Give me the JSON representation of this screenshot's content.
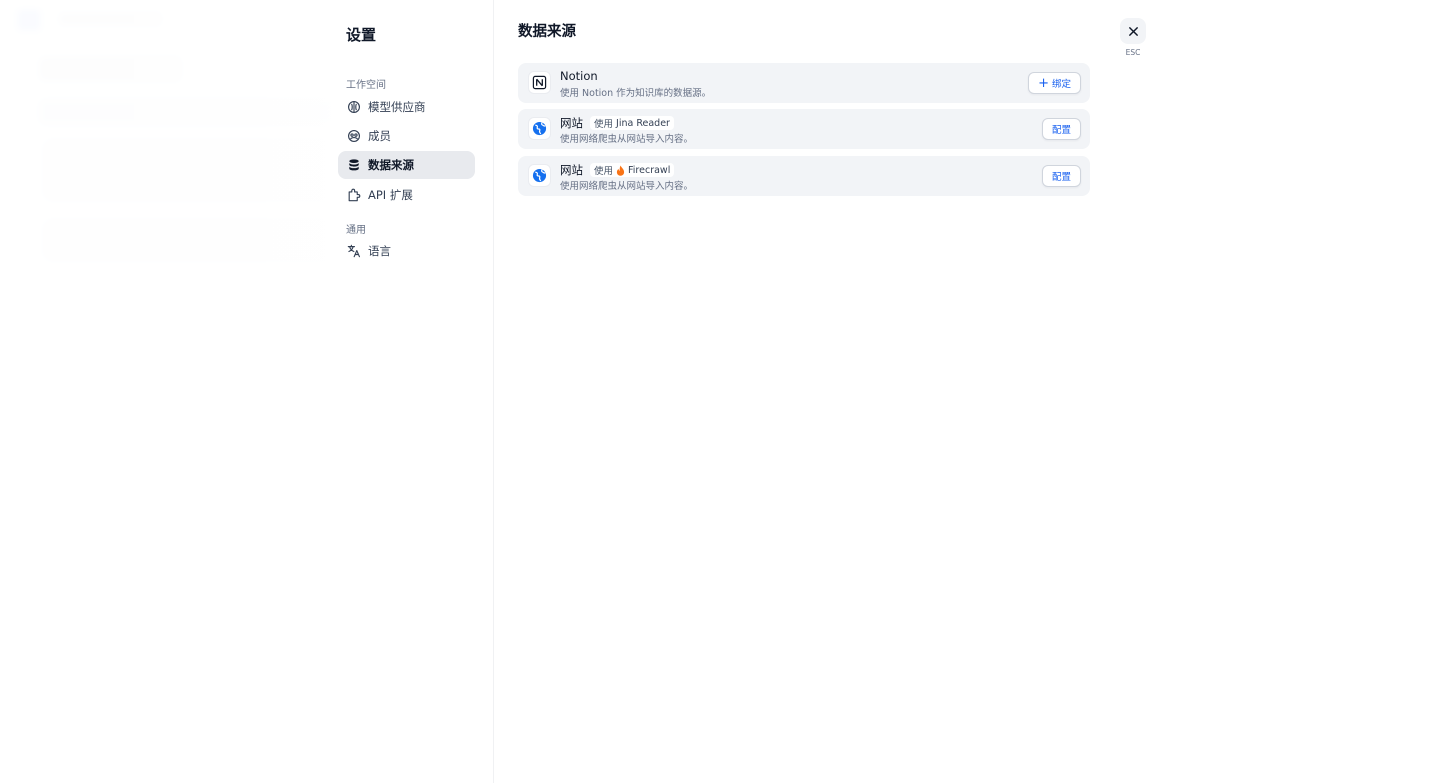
{
  "sidebar": {
    "title": "设置",
    "groups": [
      {
        "label": "工作空间",
        "items": [
          {
            "label": "模型供应商",
            "icon": "brain-icon",
            "active": false
          },
          {
            "label": "成员",
            "icon": "members-icon",
            "active": false
          },
          {
            "label": "数据来源",
            "icon": "database-icon",
            "active": true
          },
          {
            "label": "API 扩展",
            "icon": "puzzle-icon",
            "active": false
          }
        ]
      },
      {
        "label": "通用",
        "items": [
          {
            "label": "语言",
            "icon": "translate-icon",
            "active": false
          }
        ]
      }
    ]
  },
  "main": {
    "title": "数据来源",
    "close": {
      "esc_label": "ESC"
    },
    "sources": [
      {
        "title": "Notion",
        "description": "使用 Notion 作为知识库的数据源。",
        "button": "绑定",
        "icon": "notion-icon"
      },
      {
        "title": "网站",
        "pill_prefix": "使用",
        "provider": "Jina Reader",
        "description": "使用网络爬虫从网站导入内容。",
        "button": "配置",
        "icon": "globe-icon"
      },
      {
        "title": "网站",
        "pill_prefix": "使用",
        "provider": "Firecrawl",
        "description": "使用网络爬虫从网站导入内容。",
        "button": "配置",
        "icon": "globe-icon"
      }
    ]
  },
  "colors": {
    "accent": "#155eef",
    "active_nav_bg": "#e8eaee",
    "card_bg": "#f2f4f7",
    "globe_blue": "#1570ef",
    "firecrawl_orange": "#f97316"
  }
}
